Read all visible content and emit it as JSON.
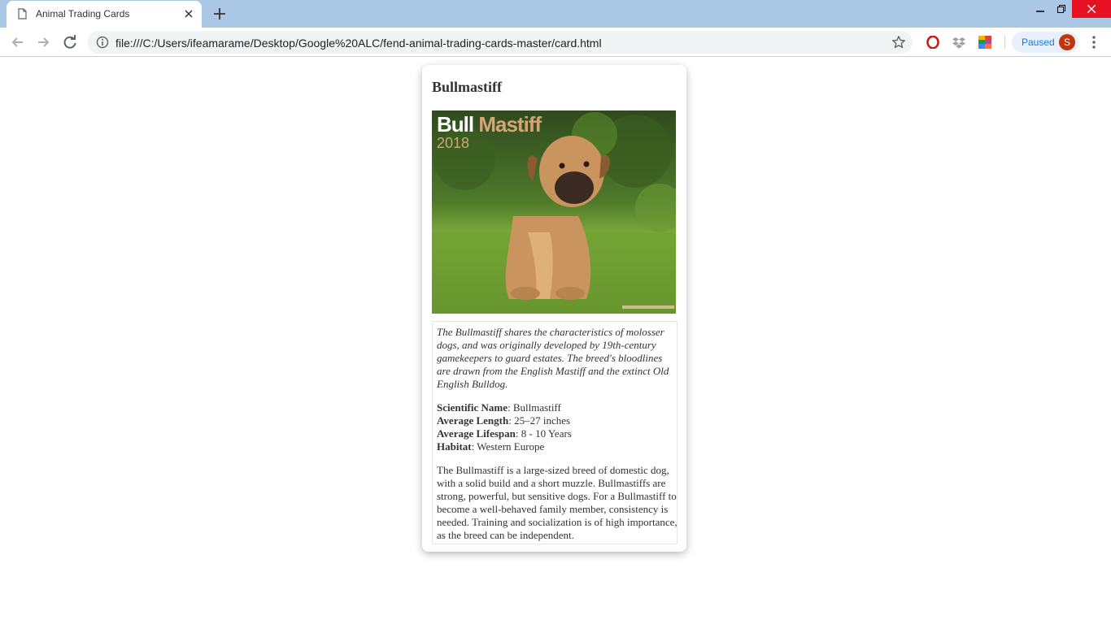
{
  "browser": {
    "tab_title": "Animal Trading Cards",
    "url": "file:///C:/Users/ifeamarame/Desktop/Google%20ALC/fend-animal-trading-cards-master/card.html",
    "profile_label": "Paused",
    "avatar_letter": "S",
    "icons": [
      "page-icon",
      "close-icon",
      "plus-icon",
      "minimize-icon",
      "restore-icon",
      "window-close-icon",
      "back-arrow-icon",
      "forward-arrow-icon",
      "reload-icon",
      "info-icon",
      "star-icon",
      "opera-icon",
      "dropbox-icon",
      "color-grid-icon",
      "kebab-menu-icon"
    ],
    "colors": {
      "titlebar": "#aac8e6",
      "close_hover": "#e81123",
      "avatar": "#c0360c",
      "accent": "#1a73e8"
    }
  },
  "card": {
    "title": "Bullmastiff",
    "image_caption_word1": "Bull",
    "image_caption_word2": "Mastiff",
    "image_caption_year": "2018",
    "intro": "The Bullmastiff shares the characteristics of molosser dogs, and was originally developed by 19th-century gamekeepers to guard estates. The breed's bloodlines are drawn from the English Mastiff and the extinct Old English Bulldog.",
    "facts": [
      {
        "label": "Scientific Name",
        "value": ": Bullmastiff"
      },
      {
        "label": "Average Length",
        "value": ": 25–27 inches"
      },
      {
        "label": "Average Lifespan",
        "value": ": 8 - 10 Years"
      },
      {
        "label": "Habitat",
        "value": ": Western Europe"
      }
    ],
    "description": "The Bullmastiff is a large-sized breed of domestic dog, with a solid build and a short muzzle. Bullmastiffs are strong, powerful, but sensitive dogs. For a Bullmastiff to become a well-behaved family member, consistency is needed. Training and socialization is of high importance, as the breed can be independent."
  }
}
